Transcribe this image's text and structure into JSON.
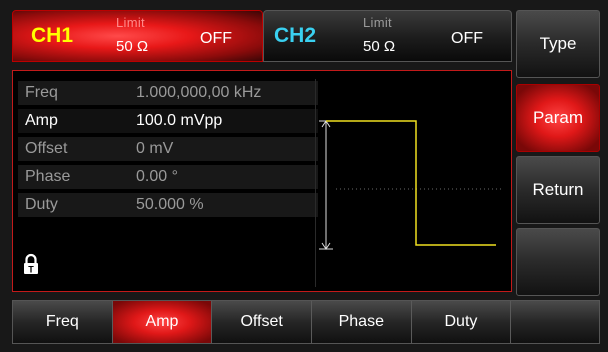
{
  "channels": {
    "ch1": {
      "name": "CH1",
      "limit_caption": "Limit",
      "limit_value": "50 Ω",
      "output": "OFF"
    },
    "ch2": {
      "name": "CH2",
      "limit_caption": "Limit",
      "limit_value": "50 Ω",
      "output": "OFF"
    }
  },
  "params": [
    {
      "label": "Freq",
      "value": "1.000,000,00 kHz",
      "selected": false
    },
    {
      "label": "Amp",
      "value": "100.0 mVpp",
      "selected": true
    },
    {
      "label": "Offset",
      "value": "0 mV",
      "selected": false
    },
    {
      "label": "Phase",
      "value": "0.00 °",
      "selected": false
    },
    {
      "label": "Duty",
      "value": "50.000 %",
      "selected": false
    }
  ],
  "waveform": {
    "type": "square",
    "duty_percent": 50,
    "color": "#f0e020"
  },
  "softkeys": [
    {
      "label": "Type",
      "active": false
    },
    {
      "label": "Param",
      "active": true
    },
    {
      "label": "Return",
      "active": false
    },
    {
      "label": "",
      "active": false
    }
  ],
  "bottom_menu": [
    {
      "label": "Freq",
      "active": false
    },
    {
      "label": "Amp",
      "active": true
    },
    {
      "label": "Offset",
      "active": false
    },
    {
      "label": "Phase",
      "active": false
    },
    {
      "label": "Duty",
      "active": false
    }
  ],
  "icons": {
    "lock": "lock-icon"
  },
  "colors": {
    "accent_red": "#e01818",
    "ch1": "#ffff00",
    "ch2": "#3ad0f0"
  }
}
